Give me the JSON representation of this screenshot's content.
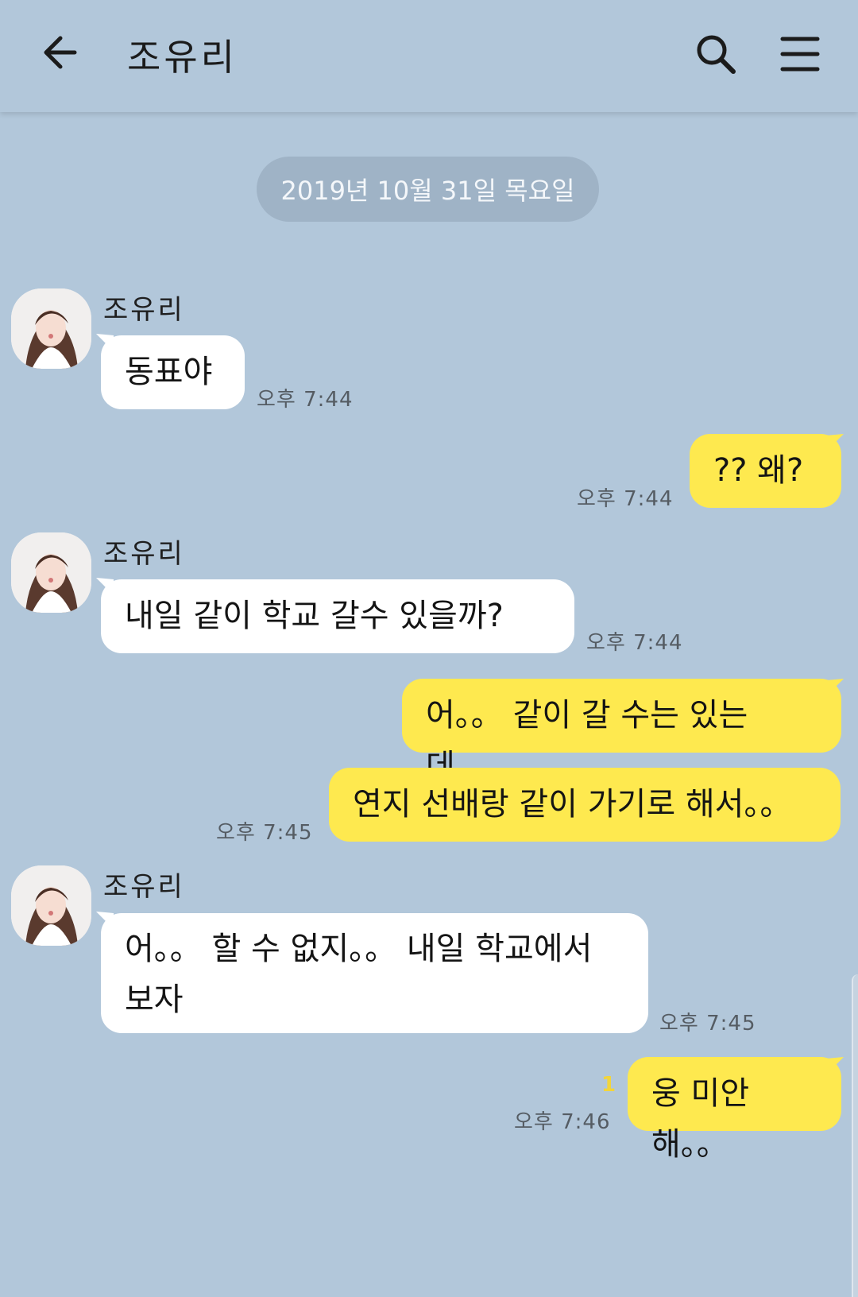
{
  "header": {
    "title": "조유리",
    "back_icon": "arrow-left-icon",
    "search_icon": "search-icon",
    "menu_icon": "hamburger-menu-icon"
  },
  "date_divider": "2019년 10월 31일 목요일",
  "messages": [
    {
      "sender": "조유리",
      "text": "동표야",
      "time": "오후 7:44"
    },
    {
      "text": "?? 왜?",
      "time": "오후 7:44"
    },
    {
      "sender": "조유리",
      "text": "내일 같이 학교 갈수 있을까?",
      "time": "오후 7:44"
    },
    {
      "text": "어。。 같이 갈 수는 있는데。。"
    },
    {
      "text": "연지 선배랑 같이 가기로 해서。。",
      "time": "오후 7:45"
    },
    {
      "sender": "조유리",
      "text_line1": "어。。 할 수 없지。。 내일 학교에서",
      "text_line2": "보자",
      "time": "오후 7:45"
    },
    {
      "text": "웅 미안해。。",
      "time": "오후 7:46",
      "unread": "1"
    }
  ],
  "colors": {
    "background": "#b2c7da",
    "incoming_bubble": "#ffffff",
    "outgoing_bubble": "#fee94f",
    "unread_count": "#f2d53c"
  }
}
